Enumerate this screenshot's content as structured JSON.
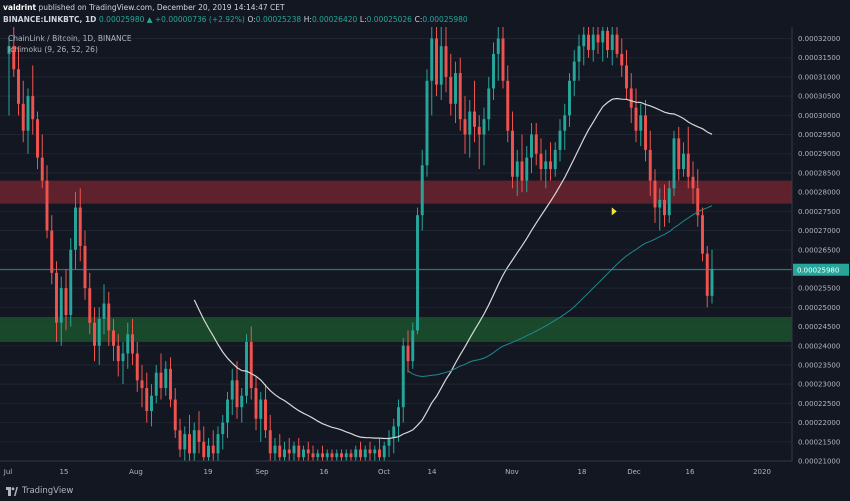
{
  "header": {
    "author": "valdrint",
    "published_text": "published on TradingView.com, December 20, 2019 14:14:47 CET",
    "symbol": "BINANCE:LINKBTC, 1D",
    "change": "0.00025980 ▲ +0.00000736 (+2.92%)",
    "open_label": "O:",
    "open": "0.00025238",
    "high_label": "H:",
    "high": "0.00026420",
    "low_label": "L:",
    "low": "0.00025026",
    "close_label": "C:",
    "close": "0.00025980"
  },
  "legend": {
    "pair": "ChainLink / Bitcoin, 1D, BINANCE",
    "indicator": "Ichimoku (9, 26, 52, 26)"
  },
  "footer": {
    "brand": "TradingView"
  },
  "colors": {
    "background": "#131722",
    "up": "#26a69a",
    "down": "#ef5350",
    "grid": "#1f2433",
    "resistance": "#7a2530",
    "support": "#1d5a2e",
    "ma_white": "#d8d8d8",
    "ma_teal": "#1d8a8f",
    "price_line": "#26a69a",
    "marker": "#f5e33a"
  },
  "chart_data": {
    "type": "candlestick",
    "ylim": [
      0.00021,
      0.000323
    ],
    "y_ticks": [
      "0.00032000",
      "0.00031500",
      "0.00031000",
      "0.00030500",
      "0.00030000",
      "0.00029500",
      "0.00029000",
      "0.00028500",
      "0.00028000",
      "0.00027500",
      "0.00027000",
      "0.00026500",
      "0.00026000",
      "0.00025500",
      "0.00025000",
      "0.00024500",
      "0.00024000",
      "0.00023500",
      "0.00023000",
      "0.00022500",
      "0.00022000",
      "0.00021500",
      "0.00021000"
    ],
    "x_ticks": [
      "Jul",
      "15",
      "Aug",
      "19",
      "Sep",
      "16",
      "Oct",
      "14",
      "Nov",
      "18",
      "Dec",
      "16",
      "2020"
    ],
    "current_price": 0.0002598,
    "current_price_label": "0.00025980",
    "zones": [
      {
        "name": "resistance",
        "from": 0.000277,
        "to": 0.000283
      },
      {
        "name": "support",
        "from": 0.000241,
        "to": 0.0002475
      }
    ],
    "ohlc": [
      [
        0.000316,
        0.00032,
        0.0003,
        0.000318
      ],
      [
        0.000318,
        0.000323,
        0.00031,
        0.000312
      ],
      [
        0.000312,
        0.000318,
        0.0003,
        0.000303
      ],
      [
        0.000303,
        0.000309,
        0.000293,
        0.000296
      ],
      [
        0.000296,
        0.000307,
        0.00029,
        0.000305
      ],
      [
        0.000305,
        0.000313,
        0.000295,
        0.000299
      ],
      [
        0.000299,
        0.000301,
        0.000286,
        0.000289
      ],
      [
        0.000289,
        0.000295,
        0.000281,
        0.000283
      ],
      [
        0.000283,
        0.000287,
        0.000268,
        0.00027
      ],
      [
        0.00027,
        0.000274,
        0.000256,
        0.000259
      ],
      [
        0.000259,
        0.000262,
        0.000241,
        0.000246
      ],
      [
        0.000246,
        0.000258,
        0.00024,
        0.000255
      ],
      [
        0.000255,
        0.00026,
        0.000244,
        0.000248
      ],
      [
        0.000248,
        0.000268,
        0.000245,
        0.000265
      ],
      [
        0.000265,
        0.00028,
        0.00026,
        0.000276
      ],
      [
        0.000276,
        0.000281,
        0.000262,
        0.000266
      ],
      [
        0.000266,
        0.00027,
        0.000252,
        0.000255
      ],
      [
        0.000255,
        0.000259,
        0.000243,
        0.000246
      ],
      [
        0.000246,
        0.00025,
        0.000236,
        0.00024
      ],
      [
        0.00024,
        0.00025,
        0.000235,
        0.000247
      ],
      [
        0.000247,
        0.000256,
        0.000243,
        0.000251
      ],
      [
        0.000251,
        0.000254,
        0.00024,
        0.000244
      ],
      [
        0.000244,
        0.000247,
        0.000236,
        0.00024
      ],
      [
        0.00024,
        0.000243,
        0.000232,
        0.000236
      ],
      [
        0.000236,
        0.000241,
        0.00023,
        0.000238
      ],
      [
        0.000238,
        0.000246,
        0.000234,
        0.000243
      ],
      [
        0.000243,
        0.000247,
        0.000235,
        0.000238
      ],
      [
        0.000238,
        0.000241,
        0.000228,
        0.000231
      ],
      [
        0.000231,
        0.000235,
        0.000224,
        0.000229
      ],
      [
        0.000229,
        0.000233,
        0.00022,
        0.000223
      ],
      [
        0.000223,
        0.00023,
        0.000219,
        0.000227
      ],
      [
        0.000227,
        0.000235,
        0.000225,
        0.000233
      ],
      [
        0.000233,
        0.000238,
        0.000226,
        0.000229
      ],
      [
        0.000229,
        0.000236,
        0.000227,
        0.000234
      ],
      [
        0.000234,
        0.000237,
        0.000224,
        0.000226
      ],
      [
        0.000226,
        0.000229,
        0.000216,
        0.000218
      ],
      [
        0.000218,
        0.000221,
        0.000211,
        0.000213
      ],
      [
        0.000213,
        0.000219,
        0.00021,
        0.000217
      ],
      [
        0.000217,
        0.000222,
        0.00021,
        0.000212
      ],
      [
        0.000212,
        0.00022,
        0.00021,
        0.000218
      ],
      [
        0.000218,
        0.000223,
        0.000212,
        0.000215
      ],
      [
        0.000215,
        0.000219,
        0.00021,
        0.000211
      ],
      [
        0.000211,
        0.000216,
        0.00021,
        0.000214
      ],
      [
        0.000214,
        0.000218,
        0.00021,
        0.000212
      ],
      [
        0.000212,
        0.000219,
        0.00021,
        0.000217
      ],
      [
        0.000217,
        0.000222,
        0.000213,
        0.00022
      ],
      [
        0.00022,
        0.000228,
        0.000216,
        0.000226
      ],
      [
        0.000226,
        0.000234,
        0.000222,
        0.000231
      ],
      [
        0.000231,
        0.000236,
        0.000221,
        0.000224
      ],
      [
        0.000224,
        0.000229,
        0.00022,
        0.000227
      ],
      [
        0.000227,
        0.000243,
        0.000225,
        0.000241
      ],
      [
        0.000241,
        0.000245,
        0.000226,
        0.000229
      ],
      [
        0.000229,
        0.000232,
        0.000218,
        0.000221
      ],
      [
        0.000221,
        0.000228,
        0.000215,
        0.000226
      ],
      [
        0.000226,
        0.00023,
        0.000216,
        0.000218
      ],
      [
        0.000218,
        0.000222,
        0.00021,
        0.000212
      ],
      [
        0.000212,
        0.000216,
        0.00021,
        0.000214
      ],
      [
        0.000214,
        0.000217,
        0.00021,
        0.000211
      ],
      [
        0.000211,
        0.000215,
        0.00021,
        0.000213
      ],
      [
        0.000213,
        0.000216,
        0.00021,
        0.000212
      ],
      [
        0.000212,
        0.000215,
        0.00021,
        0.000214
      ],
      [
        0.000214,
        0.000216,
        0.00021,
        0.000211
      ],
      [
        0.000211,
        0.000214,
        0.00021,
        0.000213
      ],
      [
        0.000213,
        0.000215,
        0.00021,
        0.000212
      ],
      [
        0.000212,
        0.000214,
        0.00021,
        0.000211
      ],
      [
        0.000211,
        0.000213,
        0.00021,
        0.000212
      ],
      [
        0.000212,
        0.000214,
        0.00021,
        0.000211
      ],
      [
        0.000211,
        0.000213,
        0.00021,
        0.000212
      ],
      [
        0.000212,
        0.000213,
        0.00021,
        0.000211
      ],
      [
        0.000211,
        0.000213,
        0.00021,
        0.000212
      ],
      [
        0.000212,
        0.000213,
        0.00021,
        0.000211
      ],
      [
        0.000211,
        0.000213,
        0.00021,
        0.000212
      ],
      [
        0.000212,
        0.000213,
        0.00021,
        0.000211
      ],
      [
        0.000211,
        0.000214,
        0.00021,
        0.000213
      ],
      [
        0.000213,
        0.000215,
        0.00021,
        0.000211
      ],
      [
        0.000211,
        0.000214,
        0.00021,
        0.000213
      ],
      [
        0.000213,
        0.000215,
        0.00021,
        0.000212
      ],
      [
        0.000212,
        0.000214,
        0.00021,
        0.000213
      ],
      [
        0.000213,
        0.000216,
        0.00021,
        0.000211
      ],
      [
        0.000211,
        0.000215,
        0.00021,
        0.000214
      ],
      [
        0.000214,
        0.000218,
        0.000211,
        0.000216
      ],
      [
        0.000216,
        0.000221,
        0.000212,
        0.000219
      ],
      [
        0.000219,
        0.000226,
        0.000215,
        0.000224
      ],
      [
        0.000224,
        0.000242,
        0.00022,
        0.00024
      ],
      [
        0.00024,
        0.000244,
        0.000233,
        0.000236
      ],
      [
        0.000236,
        0.000246,
        0.000234,
        0.000244
      ],
      [
        0.000244,
        0.000276,
        0.000243,
        0.000274
      ],
      [
        0.000274,
        0.000291,
        0.00027,
        0.000287
      ],
      [
        0.000287,
        0.000312,
        0.000284,
        0.000309
      ],
      [
        0.000309,
        0.000323,
        0.0003,
        0.00032
      ],
      [
        0.00032,
        0.000323,
        0.000305,
        0.000308
      ],
      [
        0.000308,
        0.000323,
        0.000304,
        0.000318
      ],
      [
        0.000318,
        0.000323,
        0.000306,
        0.00031
      ],
      [
        0.00031,
        0.000316,
        0.0003,
        0.000303
      ],
      [
        0.000303,
        0.000314,
        0.000298,
        0.000311
      ],
      [
        0.000311,
        0.000315,
        0.000296,
        0.000299
      ],
      [
        0.000299,
        0.000305,
        0.00029,
        0.000295
      ],
      [
        0.000295,
        0.000304,
        0.000289,
        0.000301
      ],
      [
        0.000301,
        0.000309,
        0.000293,
        0.000297
      ],
      [
        0.000297,
        0.0003,
        0.000286,
        0.000295
      ],
      [
        0.000295,
        0.000302,
        0.000287,
        0.000299
      ],
      [
        0.000299,
        0.00031,
        0.000296,
        0.000307
      ],
      [
        0.000307,
        0.000319,
        0.000304,
        0.000316
      ],
      [
        0.000316,
        0.000323,
        0.000309,
        0.00032
      ],
      [
        0.00032,
        0.000323,
        0.000307,
        0.000309
      ],
      [
        0.000309,
        0.000313,
        0.000293,
        0.000296
      ],
      [
        0.000296,
        0.000301,
        0.000281,
        0.000284
      ],
      [
        0.000284,
        0.000291,
        0.000279,
        0.000288
      ],
      [
        0.000288,
        0.000295,
        0.00028,
        0.000283
      ],
      [
        0.000283,
        0.000292,
        0.00028,
        0.000289
      ],
      [
        0.000289,
        0.000298,
        0.000285,
        0.000295
      ],
      [
        0.000295,
        0.000298,
        0.000287,
        0.00029
      ],
      [
        0.00029,
        0.000294,
        0.000283,
        0.000286
      ],
      [
        0.000286,
        0.000291,
        0.000281,
        0.000288
      ],
      [
        0.000288,
        0.000293,
        0.000283,
        0.000286
      ],
      [
        0.000286,
        0.000293,
        0.000284,
        0.000291
      ],
      [
        0.000291,
        0.000299,
        0.000288,
        0.000296
      ],
      [
        0.000296,
        0.000303,
        0.000291,
        0.0003
      ],
      [
        0.0003,
        0.000311,
        0.000297,
        0.000309
      ],
      [
        0.000309,
        0.000317,
        0.000305,
        0.000314
      ],
      [
        0.000314,
        0.000321,
        0.000309,
        0.000318
      ],
      [
        0.000318,
        0.000323,
        0.000313,
        0.000321
      ],
      [
        0.000321,
        0.000323,
        0.000315,
        0.000317
      ],
      [
        0.000317,
        0.000323,
        0.000314,
        0.000321
      ],
      [
        0.000321,
        0.000323,
        0.000316,
        0.000319
      ],
      [
        0.000319,
        0.000323,
        0.000314,
        0.000322
      ],
      [
        0.000322,
        0.000323,
        0.000315,
        0.000317
      ],
      [
        0.000317,
        0.000323,
        0.000313,
        0.000321
      ],
      [
        0.000321,
        0.000323,
        0.000315,
        0.000316
      ],
      [
        0.000316,
        0.00032,
        0.00031,
        0.000313
      ],
      [
        0.000313,
        0.000317,
        0.000304,
        0.000307
      ],
      [
        0.000307,
        0.000311,
        0.000298,
        0.000302
      ],
      [
        0.000302,
        0.000307,
        0.000293,
        0.000296
      ],
      [
        0.000296,
        0.000303,
        0.000292,
        0.0003
      ],
      [
        0.0003,
        0.000304,
        0.000288,
        0.000291
      ],
      [
        0.000291,
        0.000296,
        0.000279,
        0.000283
      ],
      [
        0.000283,
        0.000286,
        0.000272,
        0.000276
      ],
      [
        0.000276,
        0.000281,
        0.00027,
        0.000278
      ],
      [
        0.000278,
        0.000282,
        0.000271,
        0.000274
      ],
      [
        0.000274,
        0.000283,
        0.000272,
        0.000281
      ],
      [
        0.000281,
        0.000296,
        0.000279,
        0.000294
      ],
      [
        0.000294,
        0.000297,
        0.000283,
        0.000286
      ],
      [
        0.000286,
        0.000293,
        0.000284,
        0.00029
      ],
      [
        0.00029,
        0.000297,
        0.000281,
        0.000284
      ],
      [
        0.000284,
        0.000288,
        0.000277,
        0.000281
      ],
      [
        0.000281,
        0.000286,
        0.000271,
        0.000274
      ],
      [
        0.000274,
        0.000276,
        0.000262,
        0.000264
      ],
      [
        0.000264,
        0.000266,
        0.00025,
        0.000253
      ],
      [
        0.000253,
        0.000265,
        0.000251,
        0.00026
      ]
    ]
  }
}
